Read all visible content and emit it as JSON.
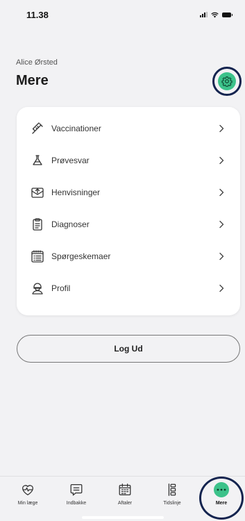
{
  "status_bar": {
    "time": "11.38"
  },
  "header": {
    "user_name": "Alice Ørsted",
    "title": "Mere",
    "settings_icon": "gear-icon"
  },
  "menu": {
    "items": [
      {
        "label": "Vaccinationer",
        "icon": "syringe-icon"
      },
      {
        "label": "Prøvesvar",
        "icon": "flask-icon"
      },
      {
        "label": "Henvisninger",
        "icon": "referral-icon"
      },
      {
        "label": "Diagnoser",
        "icon": "clipboard-icon"
      },
      {
        "label": "Spørgeskemaer",
        "icon": "questionnaire-icon"
      },
      {
        "label": "Profil",
        "icon": "profile-icon"
      }
    ]
  },
  "logout": {
    "label": "Log Ud"
  },
  "tabbar": {
    "tabs": [
      {
        "label": "Min læge",
        "icon": "heart-pulse-icon"
      },
      {
        "label": "Indbakke",
        "icon": "message-icon"
      },
      {
        "label": "Aftaler",
        "icon": "calendar-icon"
      },
      {
        "label": "Tidslinje",
        "icon": "timeline-icon"
      },
      {
        "label": "Mere",
        "icon": "more-icon",
        "active": true
      }
    ]
  },
  "colors": {
    "accent": "#3cc28a",
    "highlight_ring": "#14244f",
    "background": "#f2f2f4"
  }
}
